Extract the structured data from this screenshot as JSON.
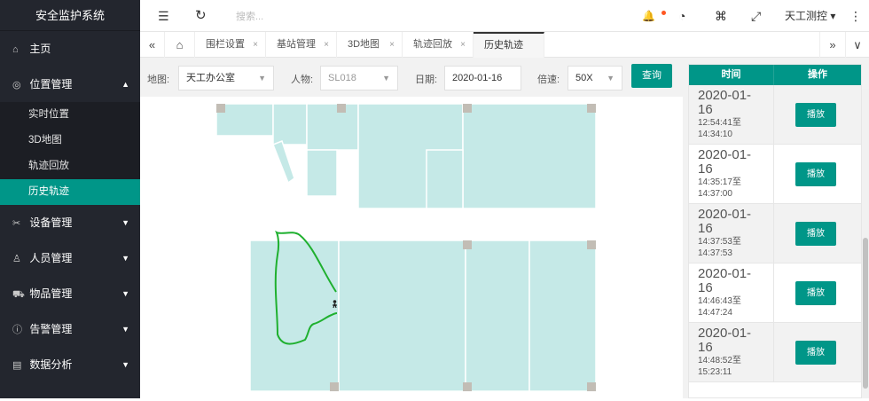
{
  "app": {
    "title": "安全监护系统"
  },
  "sidebar": {
    "items": [
      {
        "label": "主页",
        "icon": "home-icon",
        "glyph": "⌂"
      },
      {
        "label": "位置管理",
        "icon": "location-icon",
        "glyph": "◎"
      },
      {
        "label": "设备管理",
        "icon": "tools-icon",
        "glyph": "✂"
      },
      {
        "label": "人员管理",
        "icon": "user-icon",
        "glyph": "♙"
      },
      {
        "label": "物品管理",
        "icon": "cart-icon",
        "glyph": "⛟"
      },
      {
        "label": "告警管理",
        "icon": "alert-icon",
        "glyph": "ⓘ"
      },
      {
        "label": "数据分析",
        "icon": "chart-icon",
        "glyph": "▤"
      }
    ],
    "submenu": [
      "实时位置",
      "3D地图",
      "轨迹回放",
      "历史轨迹"
    ],
    "arrow_up": "▲",
    "arrow_down": "▼"
  },
  "topbar": {
    "menu_glyph": "☰",
    "refresh_glyph": "↻",
    "search_placeholder": "搜索...",
    "bell_glyph": "🔔",
    "theme_glyph": "◔",
    "tag_glyph": "⌘",
    "fullscreen_glyph": "⤢",
    "user": "天工测控 ▾",
    "more_glyph": "⋮"
  },
  "tabs": {
    "prev": "«",
    "home": "⌂",
    "items": [
      "围栏设置",
      "基站管理",
      "3D地图",
      "轨迹回放",
      "历史轨迹"
    ],
    "close": "×",
    "next": "»",
    "menu": "∨"
  },
  "filters": {
    "map_label": "地图:",
    "map_value": "天工办公室",
    "person_label": "人物:",
    "person_value": "SL018",
    "date_label": "日期:",
    "date_value": "2020-01-16",
    "speed_label": "倍速:",
    "speed_value": "50X",
    "query_button": "查询",
    "caret": "▼"
  },
  "records": {
    "headers": [
      "时间",
      "操作"
    ],
    "play_label": "播放",
    "rows": [
      {
        "date": "2020-01-",
        "day": "16",
        "start": "12:54:41至",
        "end": "14:34:10"
      },
      {
        "date": "2020-01-",
        "day": "16",
        "start": "14:35:17至",
        "end": "14:37:00"
      },
      {
        "date": "2020-01-",
        "day": "16",
        "start": "14:37:53至",
        "end": "14:37:53"
      },
      {
        "date": "2020-01-",
        "day": "16",
        "start": "14:46:43至",
        "end": "14:47:24"
      },
      {
        "date": "2020-01-",
        "day": "16",
        "start": "14:48:52至",
        "end": "15:23:11"
      }
    ]
  },
  "colors": {
    "accent": "#009688",
    "room": "#c5e9e7",
    "path": "#1fb02f",
    "sidebar": "#23262e"
  }
}
